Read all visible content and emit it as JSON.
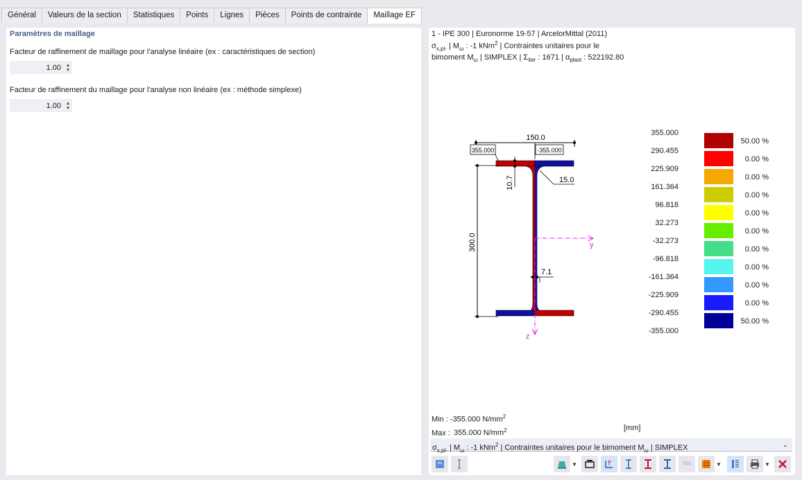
{
  "tabs": [
    {
      "label": "Général"
    },
    {
      "label": "Valeurs de la section"
    },
    {
      "label": "Statistiques"
    },
    {
      "label": "Points"
    },
    {
      "label": "Lignes"
    },
    {
      "label": "Pièces"
    },
    {
      "label": "Points de contrainte"
    },
    {
      "label": "Maillage EF",
      "active": true
    }
  ],
  "left": {
    "title": "Paramètres de maillage",
    "param1_label": "Facteur de raffinement de maillage pour l'analyse linéaire (ex : caractéristiques de section)",
    "param1_value": "1.00",
    "param2_label": "Facteur de raffinement du maillage pour l'analyse non linéaire (ex : méthode simplexe)",
    "param2_value": "1.00"
  },
  "info": {
    "line1": "1 - IPE 300 | Euronorme 19-57 | ArcelorMittal (2011)",
    "line2_a": "σ",
    "line2_sub": "x,pl-",
    "line2_b": " | M",
    "line2_sub2": "ω",
    "line2_c": " : -1 kNm",
    "line2_sup": "2",
    "line2_d": " | Contraintes unitaires pour le",
    "line3_a": "bimoment M",
    "line3_sub": "ω",
    "line3_b": " | SIMPLEX | Σ",
    "line3_sub2": "iter",
    "line3_c": " : 1671 | α",
    "line3_sub3": "plast",
    "line3_d": " : 522192.80"
  },
  "drawing": {
    "width_label": "150.0",
    "height_label": "300.0",
    "flange_label": "10.7",
    "radius_label": "15.0",
    "web_label": "7.1",
    "left_box": "355.000",
    "right_box": "-355.000",
    "axis_y": "y",
    "axis_z": "z",
    "colors": {
      "positive": "#c00000",
      "negative": "#1010a0",
      "axis": "#e020e0"
    }
  },
  "legend": {
    "values": [
      "355.000",
      "290.455",
      "225.909",
      "161.364",
      "96.818",
      "32.273",
      "-32.273",
      "-96.818",
      "-161.364",
      "-225.909",
      "-290.455",
      "-355.000"
    ],
    "colors": [
      "#b00000",
      "#ff0000",
      "#f5a800",
      "#cccc00",
      "#ffff00",
      "#66ee00",
      "#44dd88",
      "#55f5f0",
      "#3399ff",
      "#1a1aff",
      "#000099"
    ],
    "percents": [
      "50.00 %",
      "0.00 %",
      "0.00 %",
      "0.00 %",
      "0.00 %",
      "0.00 %",
      "0.00 %",
      "0.00 %",
      "0.00 %",
      "0.00 %",
      "50.00 %"
    ]
  },
  "minmax": {
    "min_label": "Min :",
    "min_value": "-355.000 N/mm",
    "max_label": "Max :",
    "max_value": "355.000 N/mm",
    "sup": "2",
    "unit": "[mm]"
  },
  "dropdown": {
    "a": "σ",
    "sub": "x,pl-",
    "b": " | M",
    "sub2": "ω",
    "c": " : -1 kNm",
    "sup": "2",
    "d": " | Contraintes unitaires pour le bimoment M",
    "sub3": "ω",
    "e": " | SIMPLEX"
  }
}
